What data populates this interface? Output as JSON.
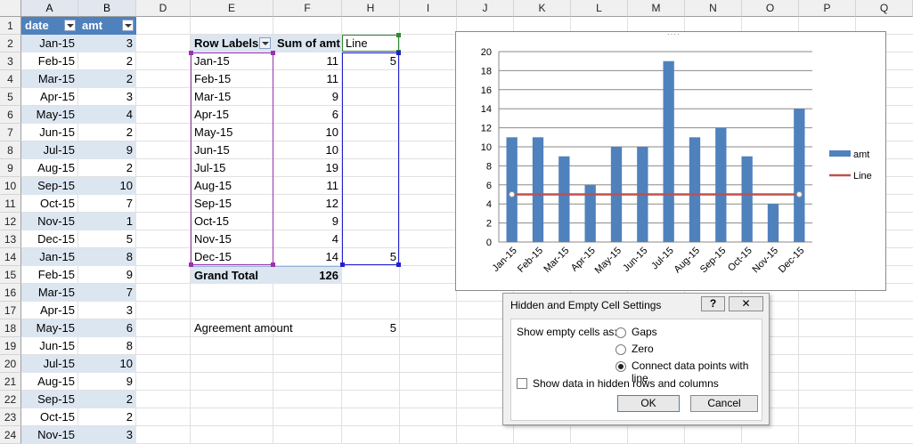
{
  "columns": [
    "A",
    "B",
    "D",
    "E",
    "F",
    "H",
    "I",
    "J",
    "K",
    "L",
    "M",
    "N",
    "O",
    "P",
    "Q"
  ],
  "rows": [
    "1",
    "2",
    "3",
    "4",
    "5",
    "6",
    "7",
    "8",
    "9",
    "10",
    "11",
    "12",
    "13",
    "14",
    "15",
    "16",
    "17",
    "18",
    "19",
    "20",
    "21",
    "22",
    "23",
    "24"
  ],
  "table": {
    "header": {
      "date": "date",
      "amt": "amt"
    },
    "rows": [
      {
        "date": "Jan-15",
        "amt": "3"
      },
      {
        "date": "Feb-15",
        "amt": "2"
      },
      {
        "date": "Mar-15",
        "amt": "2"
      },
      {
        "date": "Apr-15",
        "amt": "3"
      },
      {
        "date": "May-15",
        "amt": "4"
      },
      {
        "date": "Jun-15",
        "amt": "2"
      },
      {
        "date": "Jul-15",
        "amt": "9"
      },
      {
        "date": "Aug-15",
        "amt": "2"
      },
      {
        "date": "Sep-15",
        "amt": "10"
      },
      {
        "date": "Oct-15",
        "amt": "7"
      },
      {
        "date": "Nov-15",
        "amt": "1"
      },
      {
        "date": "Dec-15",
        "amt": "5"
      },
      {
        "date": "Jan-15",
        "amt": "8"
      },
      {
        "date": "Feb-15",
        "amt": "9"
      },
      {
        "date": "Mar-15",
        "amt": "7"
      },
      {
        "date": "Apr-15",
        "amt": "3"
      },
      {
        "date": "May-15",
        "amt": "6"
      },
      {
        "date": "Jun-15",
        "amt": "8"
      },
      {
        "date": "Jul-15",
        "amt": "10"
      },
      {
        "date": "Aug-15",
        "amt": "9"
      },
      {
        "date": "Sep-15",
        "amt": "2"
      },
      {
        "date": "Oct-15",
        "amt": "2"
      },
      {
        "date": "Nov-15",
        "amt": "3"
      }
    ]
  },
  "pivot": {
    "row_labels": "Row Labels",
    "sum_header": "Sum of amt",
    "line_header": "Line",
    "rows": [
      {
        "label": "Jan-15",
        "sum": "11",
        "line": "5"
      },
      {
        "label": "Feb-15",
        "sum": "11",
        "line": ""
      },
      {
        "label": "Mar-15",
        "sum": "9",
        "line": ""
      },
      {
        "label": "Apr-15",
        "sum": "6",
        "line": ""
      },
      {
        "label": "May-15",
        "sum": "10",
        "line": ""
      },
      {
        "label": "Jun-15",
        "sum": "10",
        "line": ""
      },
      {
        "label": "Jul-15",
        "sum": "19",
        "line": ""
      },
      {
        "label": "Aug-15",
        "sum": "11",
        "line": ""
      },
      {
        "label": "Sep-15",
        "sum": "12",
        "line": ""
      },
      {
        "label": "Oct-15",
        "sum": "9",
        "line": ""
      },
      {
        "label": "Nov-15",
        "sum": "4",
        "line": ""
      },
      {
        "label": "Dec-15",
        "sum": "14",
        "line": "5"
      }
    ],
    "grand_total_label": "Grand Total",
    "grand_total_value": "126"
  },
  "agreement": {
    "label": "Agreement amount",
    "value": "5"
  },
  "chart_data": {
    "type": "bar",
    "categories": [
      "Jan-15",
      "Feb-15",
      "Mar-15",
      "Apr-15",
      "May-15",
      "Jun-15",
      "Jul-15",
      "Aug-15",
      "Sep-15",
      "Oct-15",
      "Nov-15",
      "Dec-15"
    ],
    "series": [
      {
        "name": "amt",
        "type": "bar",
        "values": [
          11,
          11,
          9,
          6,
          10,
          10,
          19,
          11,
          12,
          9,
          4,
          14
        ],
        "color": "#4f81bd"
      },
      {
        "name": "Line",
        "type": "line",
        "values": [
          5,
          5,
          5,
          5,
          5,
          5,
          5,
          5,
          5,
          5,
          5,
          5
        ],
        "color": "#c0504d"
      }
    ],
    "yticks": [
      "0",
      "2",
      "4",
      "6",
      "8",
      "10",
      "12",
      "14",
      "16",
      "18",
      "20"
    ],
    "ylim": [
      0,
      20
    ],
    "legend_position": "right"
  },
  "dialog": {
    "title": "Hidden and Empty Cell Settings",
    "help": "?",
    "close": "✕",
    "group_label": "Show empty cells as:",
    "options": [
      "Gaps",
      "Zero",
      "Connect data points with line"
    ],
    "checkbox_label": "Show data in hidden rows and columns",
    "ok": "OK",
    "cancel": "Cancel"
  },
  "colors": {
    "accent": "#4f81bd",
    "band": "#dce6f1",
    "line": "#c0504d"
  }
}
